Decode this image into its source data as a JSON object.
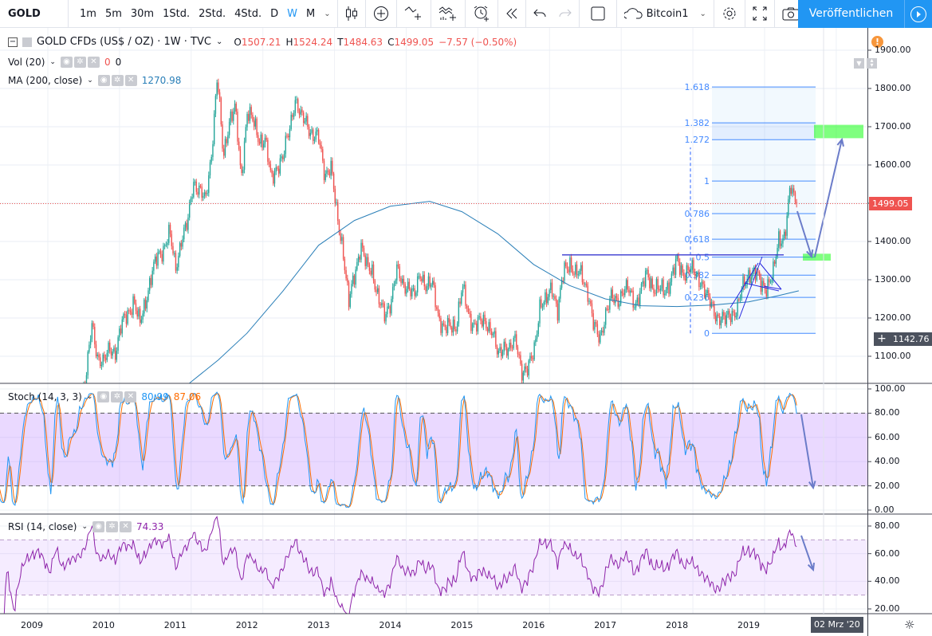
{
  "toolbar": {
    "symbol": "GOLD",
    "intervals": [
      "1m",
      "5m",
      "30m",
      "1Std.",
      "2Std.",
      "4Std.",
      "D",
      "W",
      "M"
    ],
    "active_interval": "W",
    "layout_name": "Bitcoin1",
    "publish_label": "Veröffentlichen"
  },
  "legend": {
    "title": "GOLD CFDs (US$ / OZ) · 1W · TVC",
    "o_label": "O",
    "o": "1507.21",
    "h_label": "H",
    "h": "1524.24",
    "l_label": "T",
    "l": "1484.63",
    "c_label": "C",
    "c": "1499.05",
    "change": "−7.57 (−0.50%)",
    "vol_label": "Vol (20)",
    "vol_v1": "0",
    "vol_v2": "0",
    "ma_label": "MA (200, close)",
    "ma_value": "1270.98",
    "stoch_label": "Stoch (14, 3, 3)",
    "stoch_k": "80.99",
    "stoch_d": "87.06",
    "rsi_label": "RSI (14, close)",
    "rsi_value": "74.33"
  },
  "price_axis": {
    "main": [
      "1900.00",
      "1800.00",
      "1700.00",
      "1600.00",
      "1500.00",
      "1400.00",
      "1300.00",
      "1200.00",
      "1100.00"
    ],
    "stoch": [
      "100.00",
      "80.00",
      "60.00",
      "40.00",
      "20.00",
      "0.00"
    ],
    "rsi": [
      "80.00",
      "60.00",
      "40.00",
      "20.00"
    ],
    "last_price": "1499.05",
    "crosshair_price": "1142.76"
  },
  "time_axis": {
    "years": [
      "2009",
      "2010",
      "2011",
      "2012",
      "2013",
      "2014",
      "2015",
      "2016",
      "2017",
      "2018",
      "2019"
    ],
    "crosshair_date": "02 Mrz '20"
  },
  "colors": {
    "up": "#26a69a",
    "down": "#ef5350",
    "ma": "#2a7fb8",
    "stoch_k": "#2196f3",
    "stoch_d": "#ff6d00",
    "rsi": "#8e24aa",
    "fib": "#2962ff",
    "accent": "#2196f3"
  },
  "chart_data": {
    "type": "candlestick",
    "interval": "1W",
    "monthly_closes_start": 2008.42,
    "monthly_closes": [
      930,
      915,
      830,
      880,
      720,
      815,
      870,
      920,
      940,
      920,
      885,
      975,
      925,
      950,
      955,
      1000,
      1040,
      1180,
      1100,
      1080,
      1120,
      1115,
      1180,
      1215,
      1245,
      1180,
      1250,
      1310,
      1360,
      1385,
      1420,
      1330,
      1410,
      1440,
      1560,
      1535,
      1500,
      1630,
      1830,
      1620,
      1720,
      1745,
      1565,
      1740,
      1710,
      1670,
      1665,
      1560,
      1600,
      1615,
      1690,
      1775,
      1720,
      1715,
      1675,
      1665,
      1580,
      1595,
      1470,
      1390,
      1235,
      1315,
      1395,
      1330,
      1325,
      1250,
      1200,
      1245,
      1325,
      1285,
      1290,
      1250,
      1320,
      1285,
      1285,
      1210,
      1170,
      1175,
      1185,
      1280,
      1210,
      1185,
      1185,
      1190,
      1170,
      1095,
      1135,
      1115,
      1140,
      1065,
      1060,
      1115,
      1235,
      1235,
      1290,
      1215,
      1320,
      1350,
      1310,
      1315,
      1275,
      1175,
      1150,
      1210,
      1250,
      1250,
      1270,
      1270,
      1240,
      1270,
      1320,
      1280,
      1270,
      1275,
      1305,
      1345,
      1320,
      1325,
      1315,
      1300,
      1250,
      1225,
      1200,
      1190,
      1215,
      1220,
      1280,
      1320,
      1315,
      1290,
      1285,
      1305,
      1410,
      1415,
      1540,
      1499
    ],
    "ma200": [
      [
        2011.2,
        1030
      ],
      [
        2011.6,
        1090
      ],
      [
        2012.0,
        1160
      ],
      [
        2012.5,
        1270
      ],
      [
        2013.0,
        1390
      ],
      [
        2013.5,
        1455
      ],
      [
        2014.0,
        1492
      ],
      [
        2014.55,
        1505
      ],
      [
        2015.0,
        1478
      ],
      [
        2015.5,
        1420
      ],
      [
        2016.0,
        1340
      ],
      [
        2016.5,
        1285
      ],
      [
        2017.0,
        1250
      ],
      [
        2017.5,
        1232
      ],
      [
        2018.0,
        1230
      ],
      [
        2018.5,
        1234
      ],
      [
        2019.0,
        1242
      ],
      [
        2019.4,
        1258
      ],
      [
        2019.7,
        1271
      ]
    ],
    "fibonacci": {
      "low": 1160,
      "high": 1558,
      "levels": [
        "0",
        "0.236",
        "0.382",
        "0.5",
        "0.618",
        "0.786",
        "1",
        "1.272",
        "1.382",
        "1.618"
      ]
    },
    "resistance_line": 1365,
    "targets": [
      [
        1670,
        1705
      ],
      [
        1350,
        1368
      ]
    ],
    "stoch_bands": [
      20,
      80
    ],
    "rsi_bands": [
      30,
      70
    ],
    "ylim_main": [
      1030,
      1930
    ],
    "ylim_stoch": [
      0,
      100
    ],
    "ylim_rsi": [
      18,
      88
    ]
  }
}
